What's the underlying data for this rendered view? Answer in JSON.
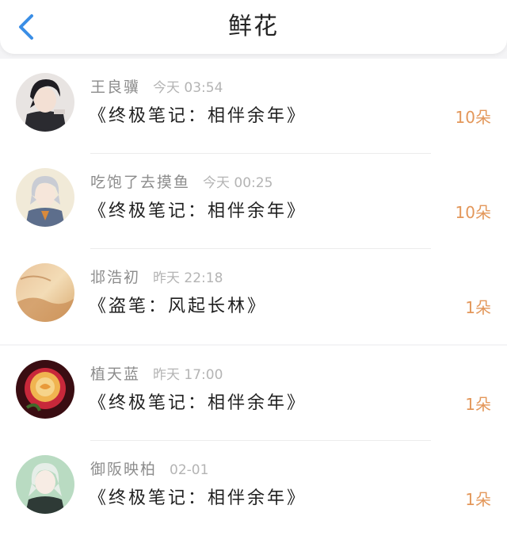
{
  "header": {
    "title": "鲜花",
    "back_icon": "chevron-left-icon",
    "accent": "#3a8ee6"
  },
  "records": [
    {
      "user": "王良骥",
      "time": "今天 03:54",
      "book": "《终极笔记：相伴余年》",
      "amount": "10朵",
      "avatar": "anime-dark-hair-avatar"
    },
    {
      "user": "吃饱了去摸鱼",
      "time": "今天 00:25",
      "book": "《终极笔记：相伴余年》",
      "amount": "10朵",
      "avatar": "anime-silver-hair-avatar"
    },
    {
      "user": "邶浩初",
      "time": "昨天 22:18",
      "book": "《盗笔：风起长林》",
      "amount": "1朵",
      "avatar": "golden-landscape-avatar"
    },
    {
      "user": "植天蓝",
      "time": "昨天 17:00",
      "book": "《终极笔记：相伴余年》",
      "amount": "1朵",
      "avatar": "rose-flower-avatar"
    },
    {
      "user": "御阪映柏",
      "time": "02-01",
      "book": "《终极笔记：相伴余年》",
      "amount": "1朵",
      "avatar": "anime-green-background-avatar"
    }
  ],
  "colors": {
    "amount": "#e3975a",
    "name": "#8c8c8c",
    "time": "#b4b4b4"
  }
}
